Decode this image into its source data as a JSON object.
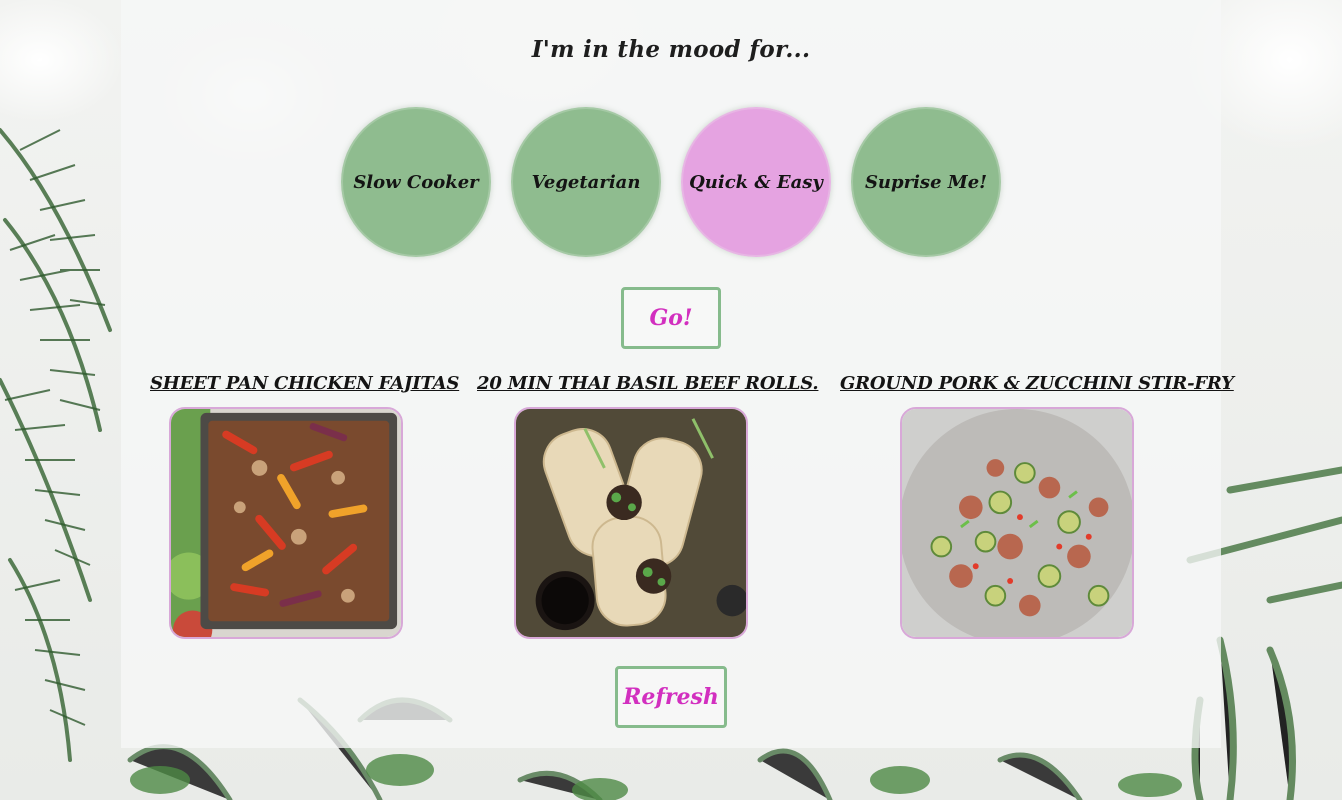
{
  "page": {
    "mood_heading": "I'm in the mood for..."
  },
  "moods": [
    {
      "label": "Slow Cooker",
      "selected": false
    },
    {
      "label": "Vegetarian",
      "selected": false
    },
    {
      "label": "Quick & Easy",
      "selected": true
    },
    {
      "label": "Suprise Me!",
      "selected": false
    }
  ],
  "actions": {
    "go_label": "Go!",
    "refresh_label": "Refresh"
  },
  "recipes": [
    {
      "title": "Sheet Pan Chicken Fajitas",
      "image_icon": "fajitas-photo"
    },
    {
      "title": "20 Min Thai Basil Beef Rolls.",
      "image_icon": "beef-rolls-photo"
    },
    {
      "title": "Ground Pork & Zucchini Stir-Fry",
      "image_icon": "stir-fry-photo"
    }
  ],
  "colors": {
    "mood_default": "#7cb27c",
    "mood_selected": "#e297de",
    "action_text": "#d22fbf",
    "action_border": "#86bb8c",
    "image_border": "#d8a8d8"
  }
}
